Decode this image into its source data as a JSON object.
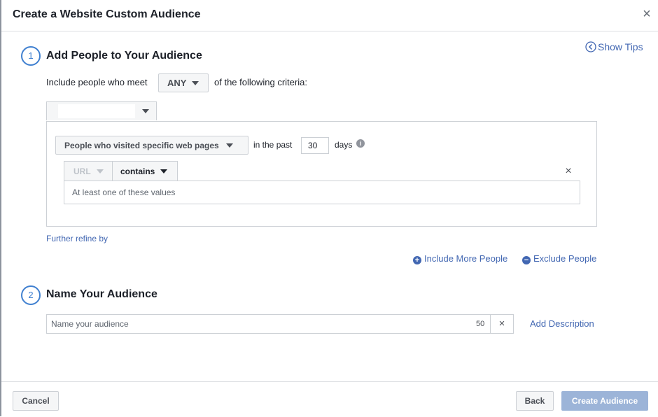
{
  "dialog": {
    "title": "Create a Website Custom Audience",
    "close_icon": "close-icon"
  },
  "tips": {
    "label": "Show Tips",
    "icon": "chevron-left-circle-icon"
  },
  "step1": {
    "number": "1",
    "title": "Add People to Your Audience",
    "include_prefix": "Include people who meet",
    "match_value": "ANY",
    "include_suffix": "of the following criteria:",
    "rule": {
      "visit_option": "People who visited specific web pages",
      "in_the_past": "in the past",
      "days_value": "30",
      "days_label": "days",
      "info_icon": "i",
      "url_label": "URL",
      "operator": "contains",
      "values_placeholder": "At least one of these values",
      "remove_icon": "×"
    },
    "further_refine": "Further refine by",
    "include_more": "Include More People",
    "include_more_icon": "+",
    "exclude": "Exclude People",
    "exclude_icon": "−"
  },
  "step2": {
    "number": "2",
    "title": "Name Your Audience",
    "name_placeholder": "Name your audience",
    "char_count": "50",
    "clear_icon": "×",
    "add_description": "Add Description"
  },
  "footer": {
    "cancel": "Cancel",
    "back": "Back",
    "create": "Create Audience"
  },
  "colors": {
    "link_blue": "#4267b2",
    "step_blue": "#4080d0",
    "disabled_primary": "#9cb4d8",
    "border": "#ccd0d5"
  }
}
